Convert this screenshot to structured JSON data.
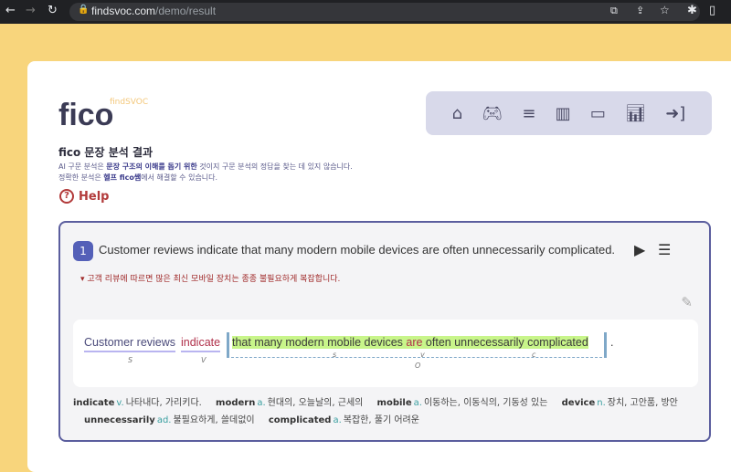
{
  "browser": {
    "url_domain": "findsvoc.com",
    "url_path": "/demo/result"
  },
  "logo": {
    "text": "fico",
    "sub": "findSVOC"
  },
  "nav": {
    "icons": [
      "home-icon",
      "gamepad-icon",
      "burger-icon",
      "books-icon",
      "ticket-icon",
      "chart-icon",
      "sign-in-icon"
    ]
  },
  "page": {
    "title": "fico 문장 분석 결과",
    "desc1_a": "AI 구문 분석은 ",
    "desc1_b": "문장 구조의 이해를 돕기 위한",
    "desc1_c": " 것이지 구문 분석의 정답을 찾는 데 있지 않습니다.",
    "desc2_a": "정확한 분석은 ",
    "desc2_b": "헬프 fico쌤",
    "desc2_c": "에서 해결할 수 있습니다.",
    "help": "Help"
  },
  "sentence": {
    "number": "1",
    "text": "Customer reviews indicate that many modern mobile devices are often unnecessarily complicated.",
    "translation": "고객 리뷰에 따르면 많은 최신 모바일 장치는 종종 불필요하게 복잡합니다.",
    "analysis": {
      "subject": "Customer reviews",
      "verb": "indicate",
      "obj_a": "that many modern mobile devices ",
      "obj_v": "are",
      "obj_b": " often unnecessarily complicated",
      "period": ".",
      "roles": {
        "s": "S",
        "v": "V",
        "o": "O",
        "inner_s": "s",
        "inner_v": "v",
        "inner_c": "c"
      }
    }
  },
  "vocab": [
    {
      "word": "indicate",
      "pos": "v.",
      "meaning": "나타내다, 가리키다."
    },
    {
      "word": "modern",
      "pos": "a.",
      "meaning": "현대의, 오늘날의, 근세의"
    },
    {
      "word": "mobile",
      "pos": "a.",
      "meaning": "이동하는, 이동식의, 기동성 있는"
    },
    {
      "word": "device",
      "pos": "n.",
      "meaning": "장치, 고안품, 방안"
    },
    {
      "word": "unnecessarily",
      "pos": "ad.",
      "meaning": "불필요하게, 쓸데없이"
    },
    {
      "word": "complicated",
      "pos": "a.",
      "meaning": "복잡한, 풀기 어려운"
    }
  ],
  "colors": {
    "accent": "#5460b8",
    "background": "#f8d57c",
    "highlight": "#c8f58a",
    "verb": "#b0304a"
  }
}
